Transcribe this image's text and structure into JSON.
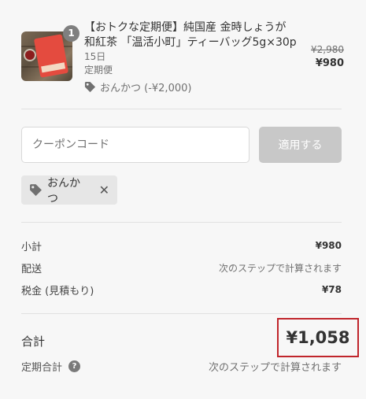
{
  "product": {
    "quantity": "1",
    "title": "【おトクな定期便】純国産 金時しょうが和紅茶 「温活小町」ティーバッグ5g×30p",
    "interval": "15日",
    "subscription": "定期便",
    "discount": "おんかつ (-¥2,000)",
    "price_original": "¥2,980",
    "price_current": "¥980"
  },
  "coupon": {
    "placeholder": "クーポンコード",
    "apply_label": "適用する",
    "applied_code": "おんかつ",
    "remove_symbol": "✕"
  },
  "summary": {
    "subtotal_label": "小計",
    "subtotal_value": "¥980",
    "shipping_label": "配送",
    "shipping_value": "次のステップで計算されます",
    "tax_label": "税金 (見積もり)",
    "tax_value": "¥78"
  },
  "total": {
    "label": "合計",
    "value": "¥1,058",
    "recurring_label": "定期合計",
    "recurring_value": "次のステップで計算されます",
    "help_symbol": "?"
  },
  "colors": {
    "highlight_border": "#c0252b",
    "button_disabled": "#c8c8c8",
    "chip_bg": "#e6e6e6"
  }
}
